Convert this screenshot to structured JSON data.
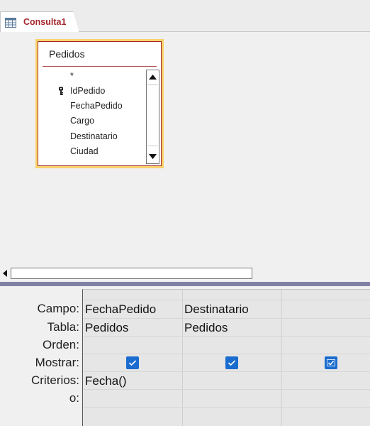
{
  "tab": {
    "label": "Consulta1",
    "icon": "query-design-icon"
  },
  "table_box": {
    "title": "Pedidos",
    "fields": [
      "*",
      "IdPedido",
      "FechaPedido",
      "Cargo",
      "Destinatario",
      "Ciudad"
    ],
    "key_field": "IdPedido"
  },
  "qbe": {
    "row_labels": {
      "campo": "Campo:",
      "tabla": "Tabla:",
      "orden": "Orden:",
      "mostrar": "Mostrar:",
      "criterios": "Criterios:",
      "o": "o:"
    },
    "columns": [
      {
        "campo": "FechaPedido",
        "tabla": "Pedidos",
        "orden": "",
        "mostrar": true,
        "criterios": "Fecha()",
        "o": ""
      },
      {
        "campo": "Destinatario",
        "tabla": "Pedidos",
        "orden": "",
        "mostrar": true,
        "criterios": "",
        "o": ""
      },
      {
        "campo": "",
        "tabla": "",
        "orden": "",
        "mostrar": true,
        "criterios": "",
        "o": ""
      }
    ]
  },
  "colors": {
    "accent": "#a4262c",
    "selection_border": "#f9d36c",
    "checkbox": "#1a6ccf",
    "splitter": "#8080a6"
  }
}
